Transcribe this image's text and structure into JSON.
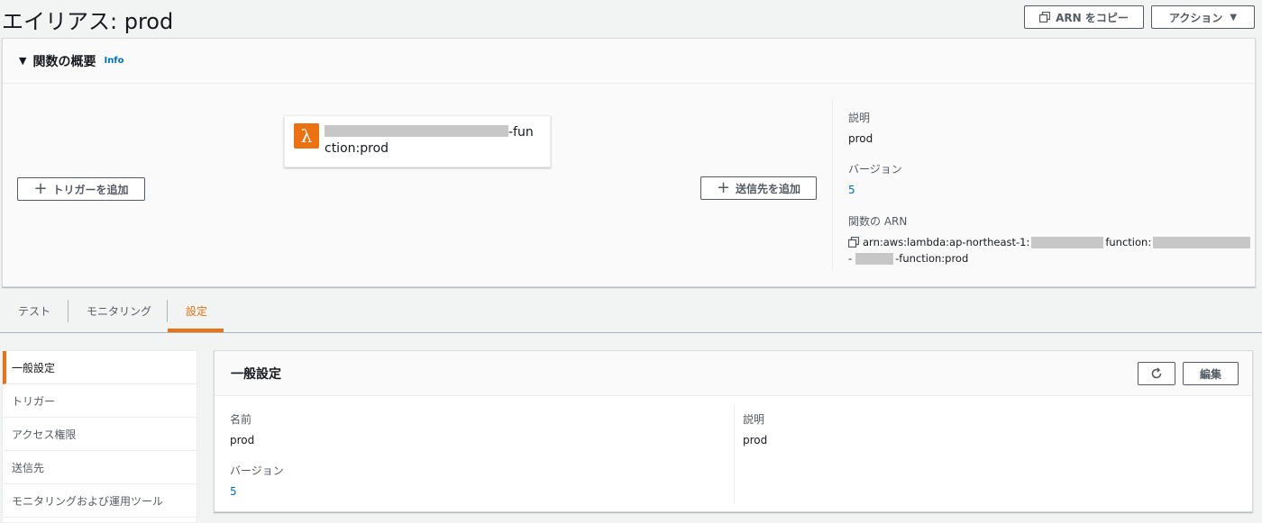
{
  "page": {
    "title": "エイリアス: prod",
    "copy_arn_label": "ARN をコピー",
    "actions_label": "アクション"
  },
  "overview": {
    "title": "関数の概要",
    "info_label": "Info",
    "function_name_line1_suffix": "-fun",
    "function_name_line2": "ction:prod",
    "add_trigger_label": "トリガーを追加",
    "add_destination_label": "送信先を追加",
    "description_label": "説明",
    "description_value": "prod",
    "version_label": "バージョン",
    "version_value": "5",
    "arn_label": "関数の ARN",
    "arn_part1": "arn:aws:lambda:ap-northeast-1:",
    "arn_part2": "function:",
    "arn_part3": "-",
    "arn_part4": "-function:prod"
  },
  "tabs": [
    {
      "label": "テスト"
    },
    {
      "label": "モニタリング"
    },
    {
      "label": "設定",
      "active": true
    }
  ],
  "sidenav": [
    {
      "label": "一般設定",
      "active": true
    },
    {
      "label": "トリガー"
    },
    {
      "label": "アクセス権限"
    },
    {
      "label": "送信先"
    },
    {
      "label": "モニタリングおよび運用ツール"
    }
  ],
  "general": {
    "title": "一般設定",
    "edit_label": "編集",
    "name_label": "名前",
    "name_value": "prod",
    "version_label": "バージョン",
    "version_value": "5",
    "description_label": "説明",
    "description_value": "prod"
  },
  "colors": {
    "accent": "#ec7211",
    "link": "#0073bb",
    "border": "#aab7b8"
  }
}
